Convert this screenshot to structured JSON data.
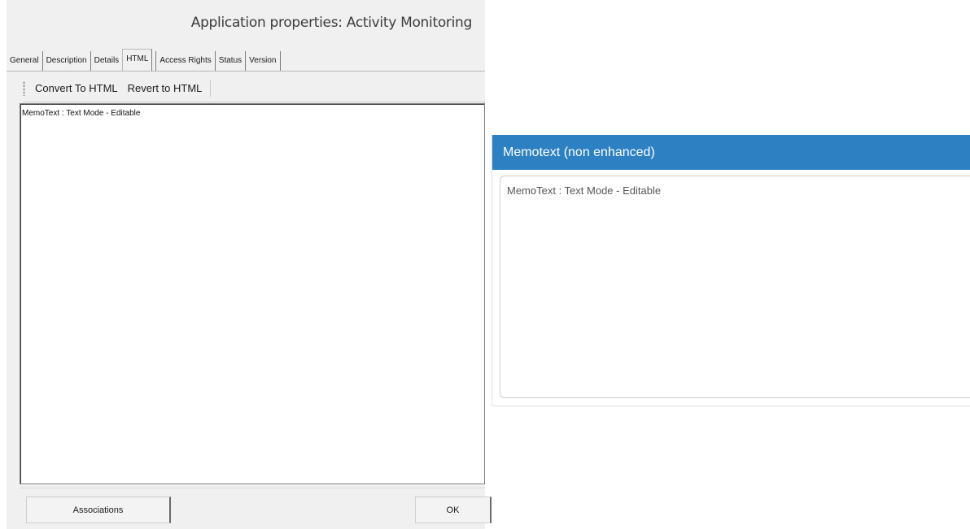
{
  "dialog": {
    "title": "Application properties: Activity Monitoring",
    "tabs": [
      {
        "label": "General"
      },
      {
        "label": "Description"
      },
      {
        "label": "Details"
      },
      {
        "label": "HTML"
      },
      {
        "label": "Access Rights"
      },
      {
        "label": "Status"
      },
      {
        "label": "Version"
      }
    ],
    "active_tab": "HTML",
    "toolbar": {
      "convert_label": "Convert To HTML",
      "revert_label": "Revert to HTML"
    },
    "memo_text": "MemoText : Text Mode - Editable",
    "buttons": {
      "associations_label": "Associations",
      "ok_label": "OK"
    }
  },
  "panel": {
    "header": "Memotext (non enhanced)",
    "textarea_value": "MemoText : Text Mode - Editable",
    "header_color": "#2d80c2"
  }
}
